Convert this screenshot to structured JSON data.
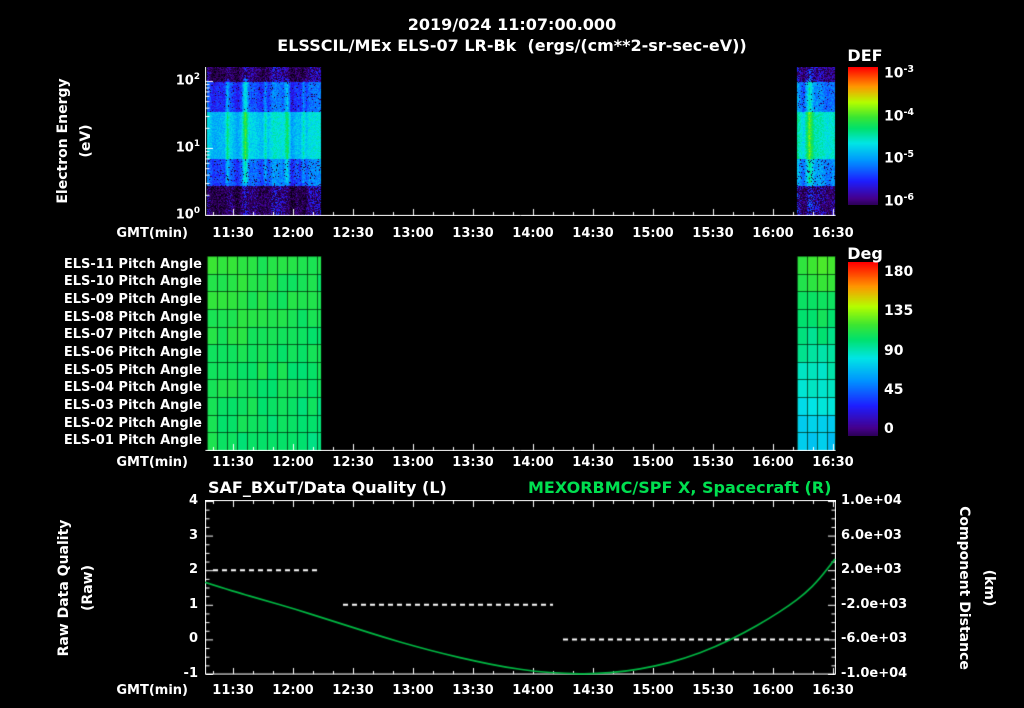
{
  "header": {
    "line1": "2019/024 11:07:00.000",
    "line2": "ELSSCIL/MEx ELS-07 LR-Bk  (ergs/(cm**2-sr-sec-eV))"
  },
  "time_axis": {
    "start": "11:16",
    "end": "16:31",
    "ticks": [
      "11:30",
      "12:00",
      "12:30",
      "13:00",
      "13:30",
      "14:00",
      "14:30",
      "15:00",
      "15:30",
      "16:00",
      "16:30"
    ]
  },
  "top_panel": {
    "y_label_line1": "Electron Energy",
    "y_label_line2": "(eV)",
    "x_label": "GMT(min)",
    "energy_ticks": [
      "10^2",
      "10^1",
      "10^0"
    ],
    "colorbar": {
      "title": "DEF",
      "ticks": [
        "10^-3",
        "10^-4",
        "10^-5",
        "10^-6"
      ]
    }
  },
  "middle_panel": {
    "x_label": "GMT(min)",
    "row_labels": [
      "ELS-11 Pitch Angle",
      "ELS-10 Pitch Angle",
      "ELS-09 Pitch Angle",
      "ELS-08 Pitch Angle",
      "ELS-07 Pitch Angle",
      "ELS-06 Pitch Angle",
      "ELS-05 Pitch Angle",
      "ELS-04 Pitch Angle",
      "ELS-03 Pitch Angle",
      "ELS-02 Pitch Angle",
      "ELS-01 Pitch Angle"
    ],
    "colorbar": {
      "title": "Deg",
      "ticks": [
        180,
        135,
        90,
        45,
        0
      ]
    }
  },
  "bottom_panel": {
    "title_left": "SAF_BXuT/Data Quality (L)",
    "title_right": "MEXORBMC/SPF X, Spacecraft (R)",
    "x_label": "GMT(min)",
    "left_axis_label_line1": "Raw Data Quality",
    "left_axis_label_line2": "(Raw)",
    "right_axis_label_line1": "Component Distance",
    "right_axis_label_line2": "(km)",
    "left_ticks": [
      "4",
      "3",
      "2",
      "1",
      "0",
      "-1"
    ],
    "right_ticks": [
      "1.0e+04",
      "6.0e+03",
      "2.0e+03",
      "-2.0e+03",
      "-6.0e+03",
      "-1.0e+04"
    ]
  },
  "colors": {
    "background": "#000000",
    "text": "#ffffff",
    "accent_green": "#00e050",
    "curve_green": "#00b843"
  },
  "chart_data": [
    {
      "type": "heatmap",
      "title": "ELSSCIL/MEx ELS-07 LR-Bk (ergs/(cm**2-sr-sec-eV))",
      "timestamp": "2019/024 11:07:00.000",
      "xlabel": "GMT(min)",
      "ylabel": "Electron Energy (eV)",
      "y_scale": "log",
      "y_ticks": [
        1,
        10,
        100
      ],
      "x_range": [
        "11:16",
        "16:31"
      ],
      "x_ticks": [
        "11:30",
        "12:00",
        "12:30",
        "13:00",
        "13:30",
        "14:00",
        "14:30",
        "15:00",
        "15:30",
        "16:00",
        "16:30"
      ],
      "colorbar": {
        "title": "DEF",
        "scale": "log",
        "ticks": [
          "1e-3",
          "1e-4",
          "1e-5",
          "1e-6"
        ]
      },
      "blocks": [
        {
          "start": "11:17",
          "end": "12:14",
          "tint": 0,
          "description": "broadband electron flux, brightest cyan band ~3-20 eV (~1e-5), patchy blue 20-100 eV, dark purple speckle below 3 eV"
        },
        {
          "start": "16:12",
          "end": "16:31",
          "tint": 0.08,
          "description": "similar coverage, slightly greener (higher flux) mid energies"
        }
      ],
      "bands": [
        {
          "f0": 0.0,
          "f1": 0.1,
          "base": 0.1,
          "amp": 0.15,
          "dropout": 0.45
        },
        {
          "f0": 0.1,
          "f1": 0.3,
          "base": 0.27,
          "amp": 0.11,
          "dropout": 0.05
        },
        {
          "f0": 0.3,
          "f1": 0.62,
          "base": 0.44,
          "amp": 0.09,
          "dropout": 0
        },
        {
          "f0": 0.62,
          "f1": 0.8,
          "base": 0.3,
          "amp": 0.11,
          "dropout": 0.08
        },
        {
          "f0": 0.8,
          "f1": 1.01,
          "base": 0.1,
          "amp": 0.17,
          "dropout": 0.5
        }
      ],
      "streaks": [
        {
          "time": "11:27",
          "width_min": 1.5,
          "boost": 0.15
        },
        {
          "time": "11:36",
          "width_min": 2,
          "boost": 0.2
        },
        {
          "time": "11:46",
          "width_min": 1.5,
          "boost": 0.12
        },
        {
          "time": "11:57",
          "width_min": 2,
          "boost": 0.17
        },
        {
          "time": "12:05",
          "width_min": 1.5,
          "boost": 0.14
        },
        {
          "time": "16:18",
          "width_min": 2.5,
          "boost": 0.16
        }
      ]
    },
    {
      "type": "heatmap",
      "rows": [
        "ELS-11 Pitch Angle",
        "ELS-10 Pitch Angle",
        "ELS-09 Pitch Angle",
        "ELS-08 Pitch Angle",
        "ELS-07 Pitch Angle",
        "ELS-06 Pitch Angle",
        "ELS-05 Pitch Angle",
        "ELS-04 Pitch Angle",
        "ELS-03 Pitch Angle",
        "ELS-02 Pitch Angle",
        "ELS-01 Pitch Angle"
      ],
      "xlabel": "GMT(min)",
      "x_range": [
        "11:16",
        "16:31"
      ],
      "colorbar": {
        "title": "Deg",
        "range": [
          0,
          180
        ],
        "ticks": [
          180,
          135,
          90,
          45,
          0
        ]
      },
      "blocks": [
        {
          "start": "11:17",
          "end": "12:14",
          "top_deg": 115,
          "bottom_deg": 108,
          "drift_deg": -5,
          "description": "~105-115 deg (green) on all anodes, 5-min cell grid"
        },
        {
          "start": "16:12",
          "end": "16:31",
          "top_deg": 118,
          "bottom_deg": 78,
          "drift_deg": 0,
          "description": "green (~115 deg) top anodes grading to cyan (~80 deg) on ELS-01..03"
        }
      ]
    },
    {
      "type": "line",
      "title_left": "SAF_BXuT/Data Quality (L)",
      "title_right": "MEXORBMC/SPF X, Spacecraft (R)",
      "xlabel": "GMT(min)",
      "x_range": [
        "11:16",
        "16:31"
      ],
      "left_axis": {
        "label": "Raw Data Quality (Raw)",
        "range": [
          -1,
          4
        ],
        "ticks": [
          4,
          3,
          2,
          1,
          0,
          -1
        ]
      },
      "right_axis": {
        "label": "Component Distance (km)",
        "range": [
          -10000,
          10000
        ],
        "ticks": [
          10000,
          6000,
          2000,
          -2000,
          -6000,
          -10000
        ]
      },
      "series": [
        {
          "name": "MEXORBMC/SPF X, Spacecraft",
          "axis": "right",
          "style": "solid",
          "color": "#00b843",
          "x": [
            "11:16",
            "11:31",
            "11:46",
            "12:01",
            "12:16",
            "12:31",
            "12:46",
            "13:01",
            "13:16",
            "13:31",
            "13:46",
            "14:01",
            "14:16",
            "14:31",
            "14:46",
            "15:01",
            "15:16",
            "15:31",
            "15:46",
            "15:58",
            "16:08",
            "16:16",
            "16:23",
            "16:31"
          ],
          "y_km": [
            600,
            -500,
            -1500,
            -2500,
            -3600,
            -4700,
            -5800,
            -6800,
            -7700,
            -8500,
            -9200,
            -9700,
            -9950,
            -10000,
            -9700,
            -9100,
            -8200,
            -6900,
            -5200,
            -3600,
            -2100,
            -700,
            900,
            3300
          ]
        },
        {
          "name": "SAF_BXuT/Data Quality",
          "axis": "left",
          "style": "dashed",
          "color": "#ffffff",
          "segments": [
            {
              "value": 2,
              "start": "11:20",
              "end": "12:12"
            },
            {
              "value": 1,
              "start": "12:25",
              "end": "14:10"
            },
            {
              "value": 0,
              "start": "14:15",
              "end": "16:30"
            }
          ]
        }
      ]
    }
  ]
}
